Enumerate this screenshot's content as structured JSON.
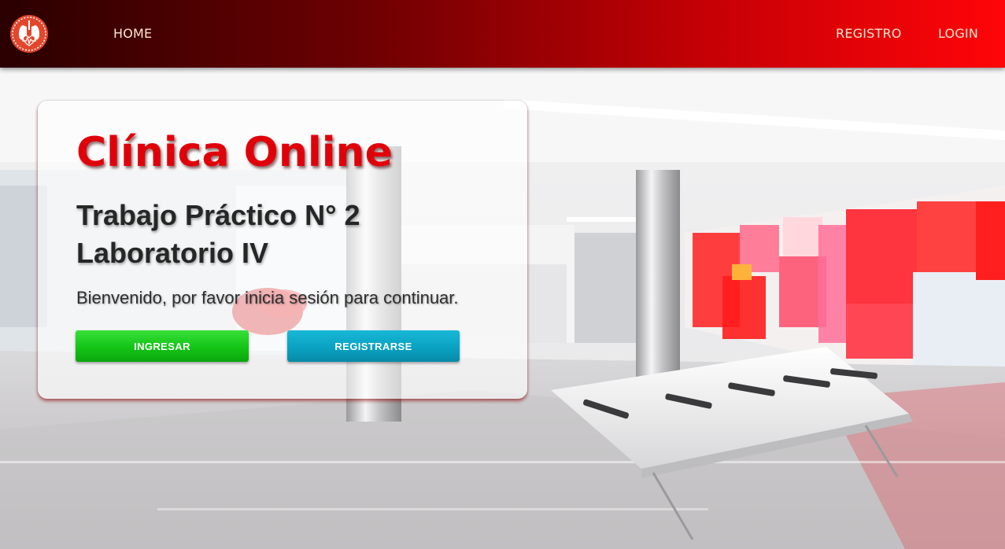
{
  "colors": {
    "navbar_start": "#2a0000",
    "navbar_end": "#ff0509",
    "accent_red": "#e0000a",
    "btn_ingresar": "#13c416",
    "btn_registrarse": "#0aa2c2",
    "nav_text": "#ffe6cf"
  },
  "navbar": {
    "logo_icon": "heart-lungs-logo-icon",
    "home_label": "HOME",
    "registro_label": "REGISTRO",
    "login_label": "LOGIN"
  },
  "hero": {
    "title": "Clínica Online",
    "subtitle_line1": "Trabajo Práctico N° 2",
    "subtitle_line2": "Laboratorio IV",
    "welcome_text": "Bienvenido, por favor inicia sesión para continuar.",
    "ingresar_label": "INGRESAR",
    "registrarse_label": "REGISTRARSE"
  }
}
